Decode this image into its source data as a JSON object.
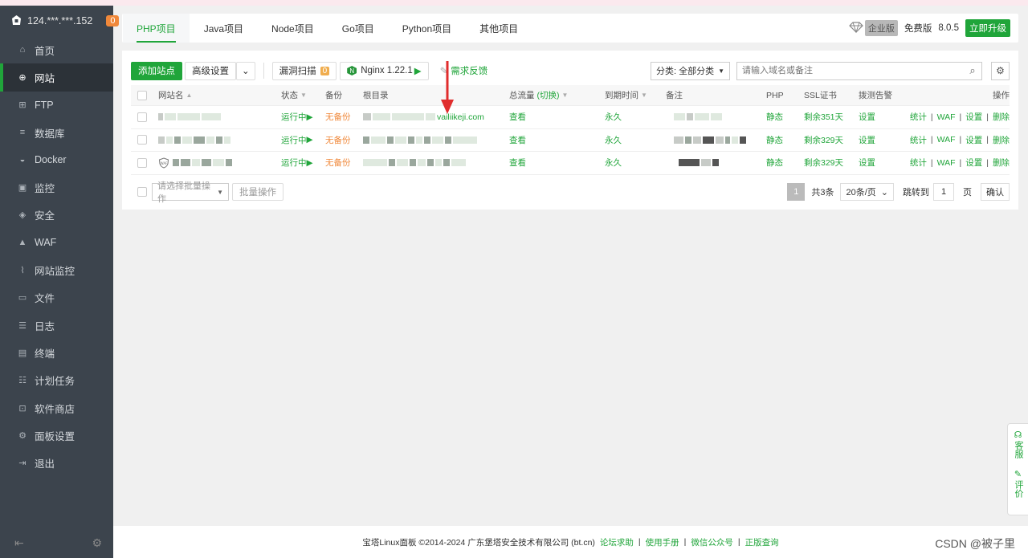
{
  "sidebar": {
    "ip": "124.***.***.152",
    "badge": "0",
    "items": [
      {
        "label": "首页",
        "icon": "home-icon"
      },
      {
        "label": "网站",
        "icon": "globe-icon"
      },
      {
        "label": "FTP",
        "icon": "ftp-icon"
      },
      {
        "label": "数据库",
        "icon": "database-icon"
      },
      {
        "label": "Docker",
        "icon": "docker-icon"
      },
      {
        "label": "监控",
        "icon": "monitor-icon"
      },
      {
        "label": "安全",
        "icon": "shield-icon"
      },
      {
        "label": "WAF",
        "icon": "waf-icon"
      },
      {
        "label": "网站监控",
        "icon": "chart-icon"
      },
      {
        "label": "文件",
        "icon": "folder-icon"
      },
      {
        "label": "日志",
        "icon": "log-icon"
      },
      {
        "label": "终端",
        "icon": "terminal-icon"
      },
      {
        "label": "计划任务",
        "icon": "task-icon"
      },
      {
        "label": "软件商店",
        "icon": "store-icon"
      },
      {
        "label": "面板设置",
        "icon": "settings-icon"
      },
      {
        "label": "退出",
        "icon": "logout-icon"
      }
    ],
    "active_index": 1
  },
  "tabs": [
    "PHP项目",
    "Java项目",
    "Node项目",
    "Go项目",
    "Python项目",
    "其他项目"
  ],
  "header_right": {
    "enterprise": "企业版",
    "free": "免费版",
    "version": "8.0.5",
    "upgrade": "立即升级"
  },
  "toolbar": {
    "add_site": "添加站点",
    "advanced": "高级设置",
    "vuln_scan": "漏洞扫描",
    "vuln_count": "0",
    "nginx": "Nginx 1.22.1",
    "feedback": "需求反馈",
    "category": "分类: 全部分类",
    "search_placeholder": "请输入域名或备注"
  },
  "table": {
    "headers": {
      "name": "网站名",
      "status": "状态",
      "backup": "备份",
      "root": "根目录",
      "traffic": "总流量",
      "traffic_switch": "(切换)",
      "expire": "到期时间",
      "remark": "备注",
      "php": "PHP",
      "ssl": "SSL证书",
      "alert": "拨测告警",
      "ops": "操作"
    },
    "rows": [
      {
        "status": "运行中",
        "backup": "无备份",
        "root": "vailiikeji.com",
        "traffic": "查看",
        "expire": "永久",
        "php": "静态",
        "ssl": "剩余351天",
        "alert": "设置"
      },
      {
        "status": "运行中",
        "backup": "无备份",
        "root": "",
        "traffic": "查看",
        "expire": "永久",
        "php": "静态",
        "ssl": "剩余329天",
        "alert": "设置"
      },
      {
        "status": "运行中",
        "backup": "无备份",
        "root": "",
        "traffic": "查看",
        "expire": "永久",
        "php": "静态",
        "ssl": "剩余329天",
        "alert": "设置"
      }
    ],
    "ops": [
      "统计",
      "WAF",
      "设置",
      "删除"
    ]
  },
  "batch": {
    "select_placeholder": "请选择批量操作",
    "button": "批量操作"
  },
  "pager": {
    "current": "1",
    "total": "共3条",
    "per_page": "20条/页",
    "jump_label": "跳转到",
    "jump_value": "1",
    "page_unit": "页",
    "confirm": "确认"
  },
  "footer": {
    "copyright": "宝塔Linux面板 ©2014-2024 广东堡塔安全技术有限公司 (bt.cn)",
    "links": [
      "论坛求助",
      "使用手册",
      "微信公众号",
      "正版查询"
    ]
  },
  "float": {
    "service": "客服",
    "review": "评价"
  },
  "watermark": "CSDN @被子里",
  "colors": {
    "accent": "#20a53a",
    "warning": "#f0883a",
    "sidebar": "#3c444d"
  }
}
